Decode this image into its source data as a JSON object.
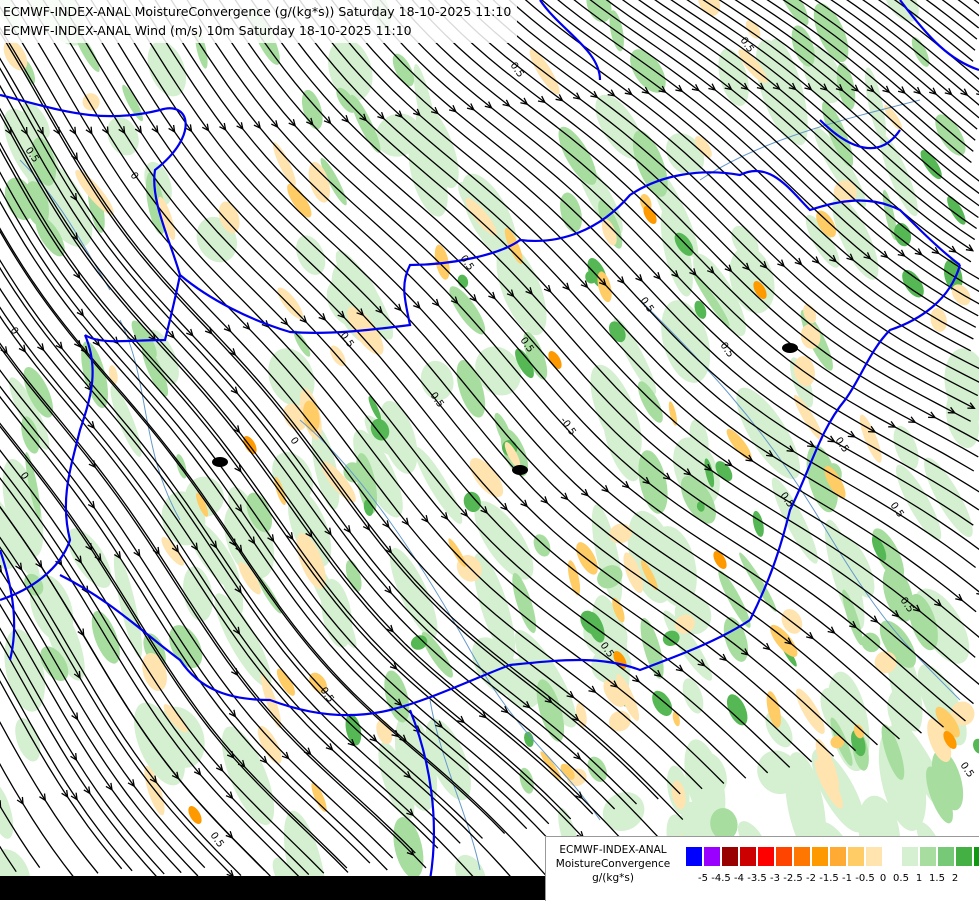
{
  "header": {
    "line1": "ECMWF-INDEX-ANAL MoistureConvergence (g/(kg*s)) Saturday 18-10-2025 11:10",
    "line2": "ECMWF-INDEX-ANAL Wind (m/s) 10m Saturday 18-10-2025 11:10"
  },
  "legend": {
    "model": "ECMWF-INDEX-ANAL",
    "parameter": "MoistureConvergence",
    "unit": "g/(kg*s)",
    "colors": [
      "#0000ff",
      "#9900ff",
      "#990000",
      "#cc0000",
      "#ff0000",
      "#ff4400",
      "#ff7700",
      "#ff9900",
      "#ffaa33",
      "#ffcc66",
      "#ffe4b0",
      "#ffffff",
      "#d4f0d0",
      "#a8dda0",
      "#77c877",
      "#44b044",
      "#109910"
    ],
    "tick_labels": [
      "-5",
      "-4.5",
      "-4",
      "-3.5",
      "-3",
      "-2.5",
      "-2",
      "-1.5",
      "-1",
      "-0.5",
      "0",
      "0.5",
      "1",
      "1.5",
      "2"
    ]
  },
  "map": {
    "contour_labels": [
      "0",
      "0.5",
      "-0.5"
    ],
    "colors": {
      "border": "#0000ee",
      "river": "#6699cc",
      "streamline": "#000000",
      "conv_light": "#d4f0d0",
      "conv_mid": "#a8dda0",
      "conv_strong": "#55b855",
      "div_light": "#ffe4b0",
      "div_mid": "#ffcc66",
      "div_strong": "#ff9900"
    }
  }
}
